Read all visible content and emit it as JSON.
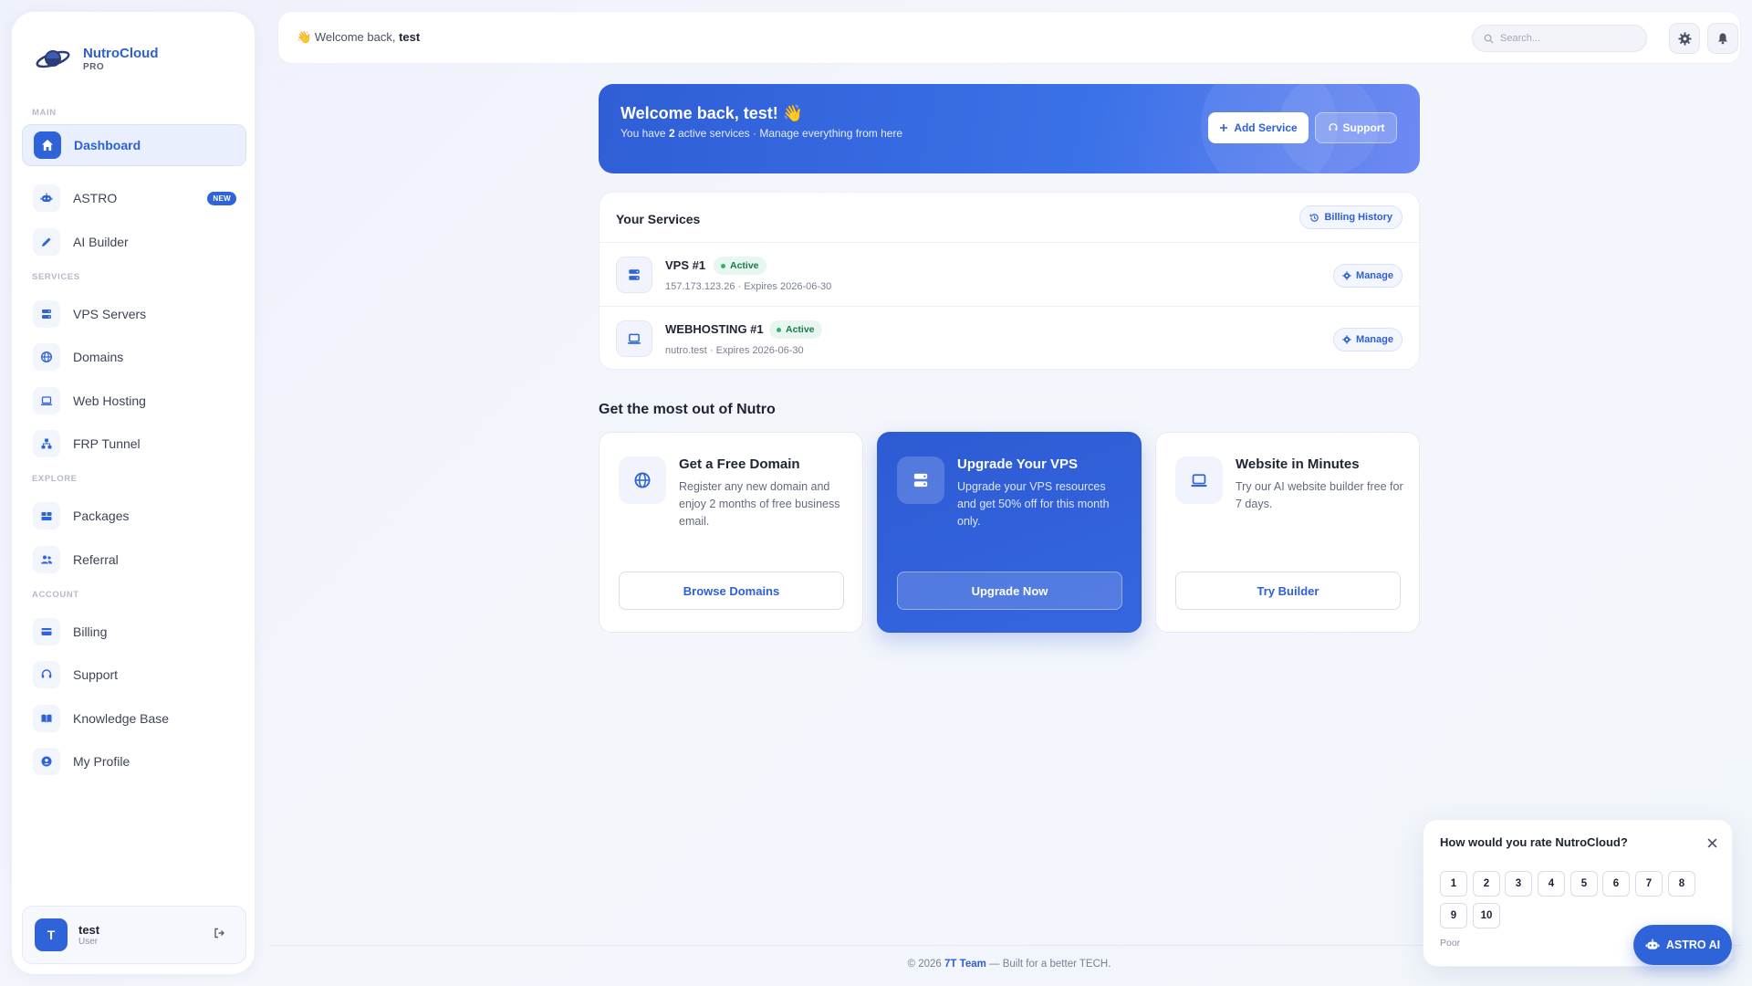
{
  "brand": {
    "name": "NutroCloud",
    "tier": "PRO"
  },
  "sidebar": {
    "sections": {
      "main": "MAIN",
      "services": "SERVICES",
      "explore": "EXPLORE",
      "account": "ACCOUNT"
    },
    "items": [
      {
        "label": "Dashboard",
        "icon": "home-icon"
      },
      {
        "label": "ASTRO",
        "icon": "robot-icon",
        "badge": "NEW"
      },
      {
        "label": "AI Builder",
        "icon": "pencil-icon"
      },
      {
        "label": "VPS Servers",
        "icon": "server-icon"
      },
      {
        "label": "Domains",
        "icon": "globe-icon"
      },
      {
        "label": "Web Hosting",
        "icon": "laptop-icon"
      },
      {
        "label": "FRP Tunnel",
        "icon": "network-icon"
      },
      {
        "label": "Packages",
        "icon": "boxes-icon"
      },
      {
        "label": "Referral",
        "icon": "users-icon"
      },
      {
        "label": "Billing",
        "icon": "credit-card-icon"
      },
      {
        "label": "Support",
        "icon": "headset-icon"
      },
      {
        "label": "Knowledge Base",
        "icon": "book-icon"
      },
      {
        "label": "My Profile",
        "icon": "user-circle-icon"
      }
    ],
    "user": {
      "initial": "T",
      "name": "test",
      "role": "User"
    }
  },
  "topbar": {
    "emoji": "👋",
    "greeting_prefix": "Welcome back,",
    "username": "test",
    "search_placeholder": "Search..."
  },
  "hero": {
    "title": "Welcome back, test! 👋",
    "sub_prefix": "You have",
    "count": "2",
    "sub_suffix": "active services · Manage everything from here",
    "add_label": "Add Service",
    "support_label": "Support"
  },
  "services": {
    "title": "Your Services",
    "billing_label": "Billing History",
    "manage_label": "Manage",
    "items": [
      {
        "name": "VPS #1",
        "status": "Active",
        "meta": "157.173.123.26 · Expires 2026-06-30"
      },
      {
        "name": "WEBHOSTING #1",
        "status": "Active",
        "meta": "nutro.test · Expires 2026-06-30"
      }
    ]
  },
  "promo": {
    "heading": "Get the most out of Nutro",
    "cards": [
      {
        "title": "Get a Free Domain",
        "desc": "Register any new domain and enjoy 2 months of free business email.",
        "button": "Browse Domains",
        "icon": "globe-icon"
      },
      {
        "title": "Upgrade Your VPS",
        "desc": "Upgrade your VPS resources and get 50% off for this month only.",
        "button": "Upgrade Now",
        "icon": "server-icon"
      },
      {
        "title": "Website in Minutes",
        "desc": "Try our AI website builder free for 7 days.",
        "button": "Try Builder",
        "icon": "laptop-icon"
      }
    ]
  },
  "rating": {
    "question": "How would you rate NutroCloud?",
    "options": [
      "1",
      "2",
      "3",
      "4",
      "5",
      "6",
      "7",
      "8",
      "9",
      "10"
    ],
    "hint": "Poor"
  },
  "astro_fab": {
    "label": "ASTRO AI"
  },
  "footer": {
    "prefix": "© 2026",
    "team": "7T Team",
    "suffix": "— Built for a better TECH."
  },
  "colors": {
    "accent": "#2f64d8",
    "status_active": "#2fb36b"
  }
}
